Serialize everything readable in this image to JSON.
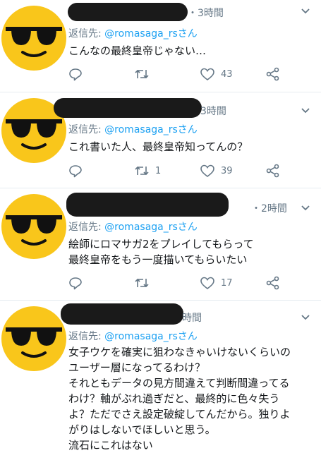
{
  "tweets": [
    {
      "time": "・3時間",
      "reply_prefix": "返信先: ",
      "reply_handle": "@romasaga_rsさん",
      "text": "こんなの最終皇帝じゃない…",
      "retweets": "",
      "likes": "43"
    },
    {
      "time": "3時間",
      "reply_prefix": "返信先: ",
      "reply_handle": "@romasaga_rsさん",
      "text": "これ書いた人、最終皇帝知ってんの？",
      "retweets": "1",
      "likes": "39"
    },
    {
      "time": "・2時間",
      "reply_prefix": "返信先: ",
      "reply_handle": "@romasaga_rsさん",
      "text": "絵師にロマサガ2をプレイしてもらって\n最終皇帝をもう一度描いてもらいたい",
      "retweets": "",
      "likes": "17"
    },
    {
      "time": "時間",
      "reply_prefix": "返信先: ",
      "reply_handle": "@romasaga_rsさん",
      "text": "女子ウケを確実に狙わなきゃいけないくらいの\nユーザー層になってるわけ？\nそれともデータの見方間違えて判断間違ってる\nわけ？軸がぶれ過ぎだと、最終的に色々失う\nよ？ただでさえ設定破綻してんだから。独りよ\nがりはしないでほしいと思う。\n流石にこれはない",
      "retweets": "",
      "likes": ""
    }
  ],
  "colors": {
    "accent": "#1da1f2",
    "meta": "#657786",
    "avatar": "#f9c61b"
  },
  "icons": [
    "sunglasses-emoji-avatar",
    "reply-icon",
    "retweet-icon",
    "like-icon",
    "share-icon",
    "chevron-down-icon"
  ]
}
